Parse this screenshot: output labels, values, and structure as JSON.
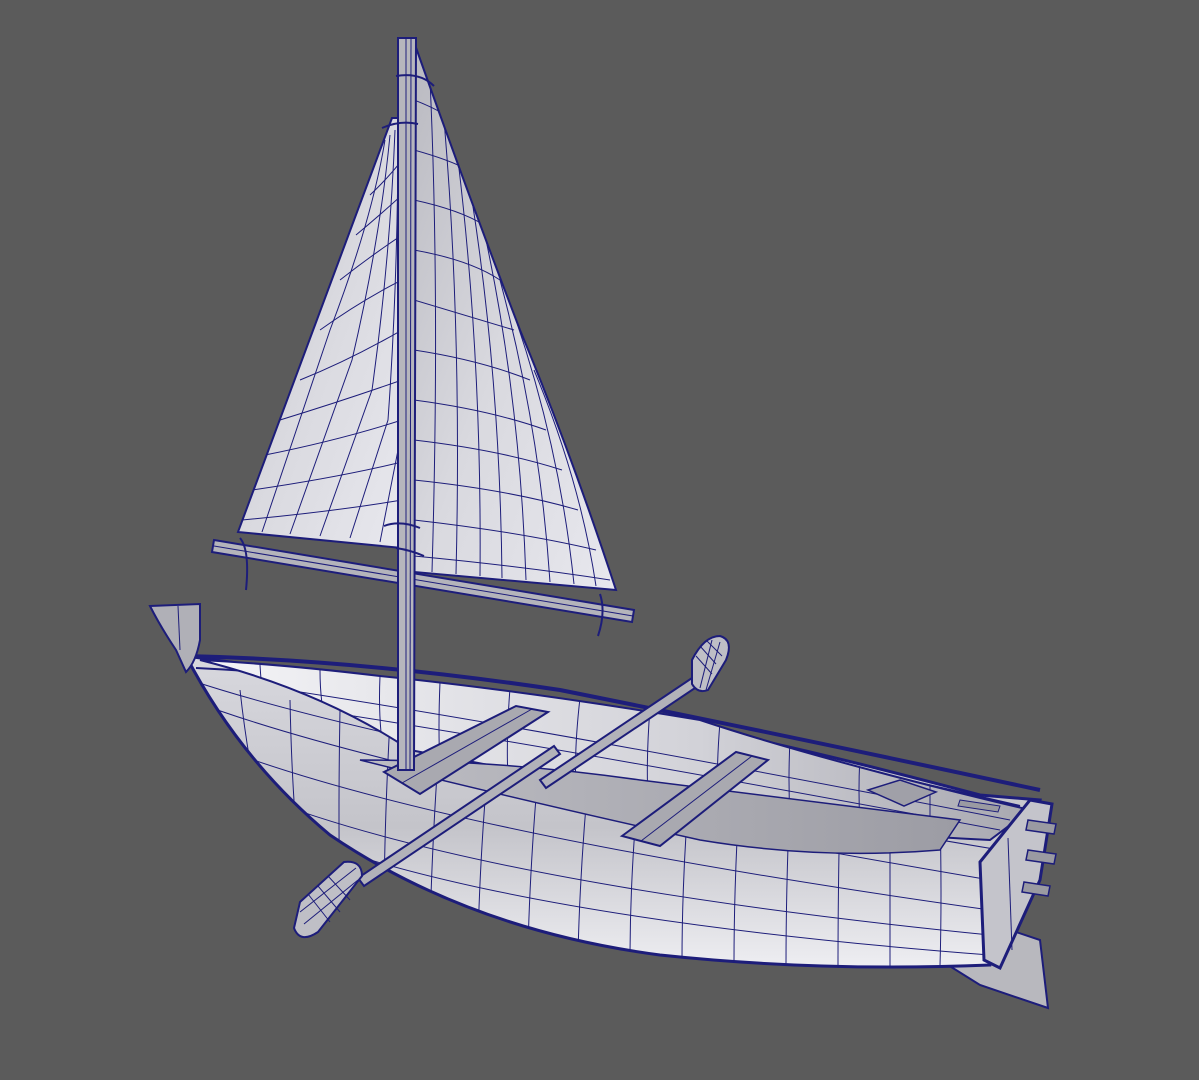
{
  "viewport": {
    "background_color": "#5b5b5b",
    "wire_color": "#1d1d7a",
    "surface_light": "#e9e9ee",
    "surface_mid": "#c2c2c8",
    "surface_dark": "#8e8e96"
  },
  "scene": {
    "objects": [
      "mast",
      "sail",
      "boom",
      "hull",
      "gunwale",
      "thwart-seats",
      "rudder",
      "oar-left",
      "oar-right",
      "oarlock",
      "bow-stem"
    ]
  }
}
